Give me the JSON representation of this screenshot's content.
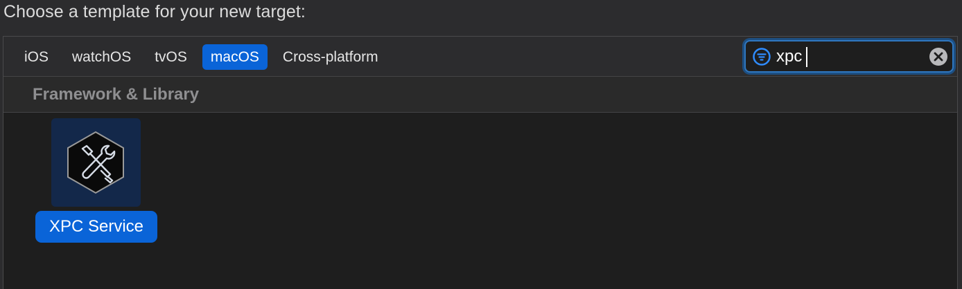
{
  "heading": "Choose a template for your new target:",
  "tabs": [
    {
      "label": "iOS",
      "selected": false
    },
    {
      "label": "watchOS",
      "selected": false
    },
    {
      "label": "tvOS",
      "selected": false
    },
    {
      "label": "macOS",
      "selected": true
    },
    {
      "label": "Cross-platform",
      "selected": false
    }
  ],
  "search": {
    "value": "xpc",
    "filter_icon": "filter-icon",
    "clear_icon": "clear-icon"
  },
  "section": {
    "title": "Framework & Library"
  },
  "templates": [
    {
      "label": "XPC Service",
      "icon": "tools-icon",
      "selected": true
    }
  ],
  "colors": {
    "accent": "#0a64d8",
    "background": "#1e1e1e"
  }
}
